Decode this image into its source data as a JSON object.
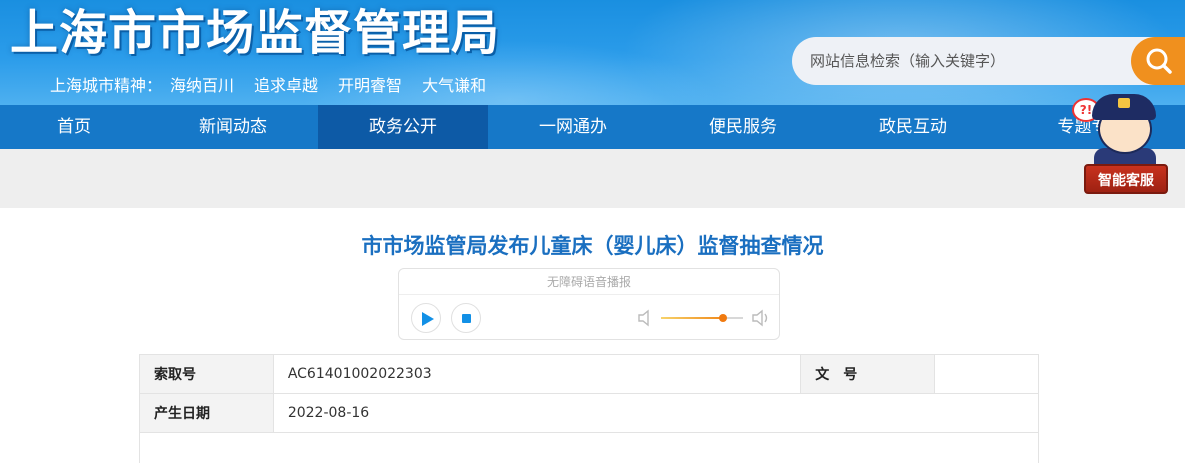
{
  "header": {
    "site_title": "上海市市场监督管理局",
    "slogan_label": "上海城市精神：",
    "slogan_phrases": [
      "海纳百川",
      "追求卓越",
      "开明睿智",
      "大气谦和"
    ],
    "search_placeholder": "网站信息检索（输入关键字）"
  },
  "nav": {
    "items": [
      {
        "label": "首页"
      },
      {
        "label": "新闻动态"
      },
      {
        "label": "政务公开"
      },
      {
        "label": "一网通办"
      },
      {
        "label": "便民服务"
      },
      {
        "label": "政民互动"
      },
      {
        "label": "专题专"
      }
    ],
    "active_index": 2
  },
  "service_widget": {
    "bubble_text": "?!",
    "label": "智能客服"
  },
  "article": {
    "title": "市市场监管局发布儿童床（婴儿床）监督抽查情况"
  },
  "audio_player": {
    "label": "无障碍语音播报",
    "volume_level": 0.75
  },
  "info_table": {
    "row1": {
      "key1": "索取号",
      "value1": "AC61401002022303",
      "key2": "文　号",
      "value2": ""
    },
    "row2": {
      "key1": "产生日期",
      "value1": "2022-08-16"
    }
  },
  "colors": {
    "header_blue": "#1a8fe0",
    "nav_blue": "#1678c8",
    "nav_active": "#0d5aa6",
    "search_orange": "#f0901e",
    "title_blue": "#1a6fc0",
    "player_blue": "#1290e6",
    "volume_orange": "#f07a10"
  }
}
